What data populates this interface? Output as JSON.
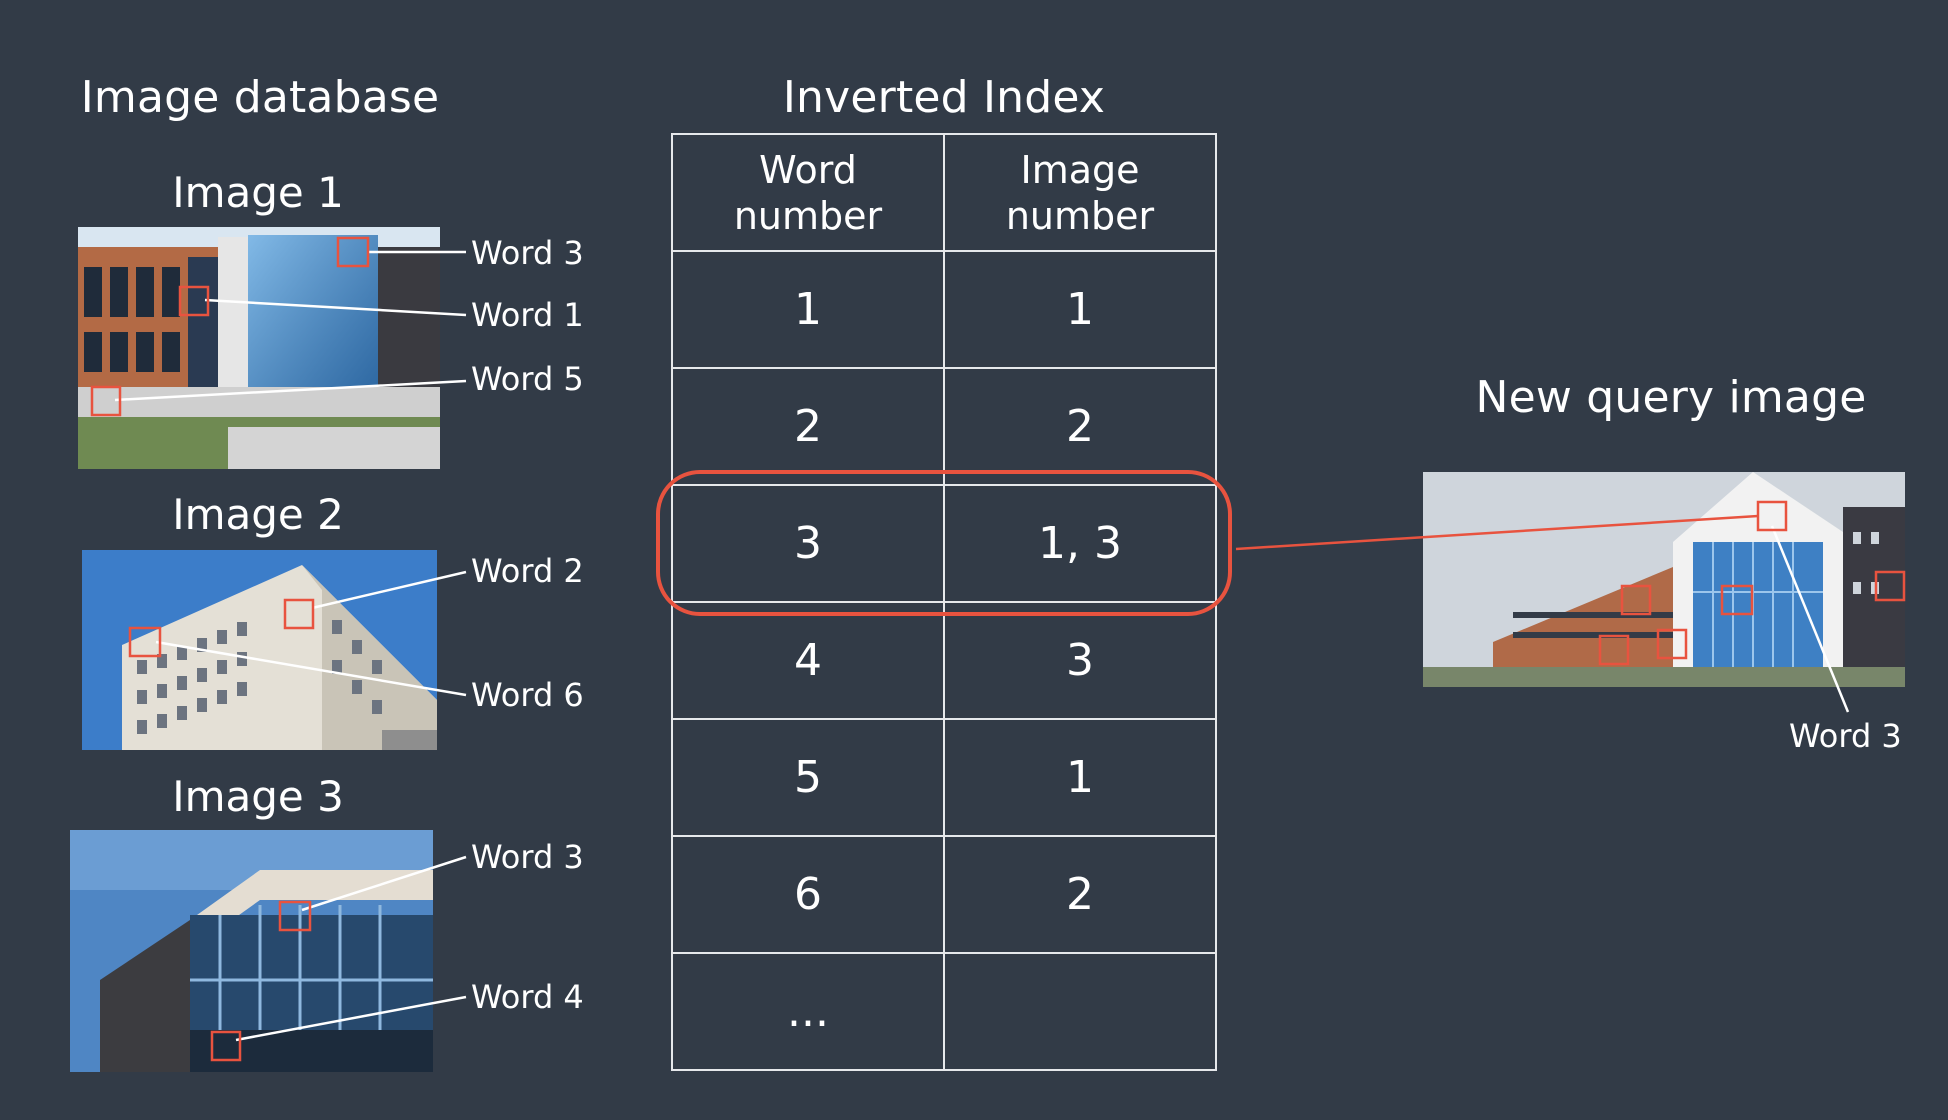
{
  "headings": {
    "database": "Image database",
    "index": "Inverted Index",
    "query": "New query image"
  },
  "images": [
    {
      "label": "Image 1",
      "words": [
        "Word 3",
        "Word 1",
        "Word 5"
      ]
    },
    {
      "label": "Image 2",
      "words": [
        "Word 2",
        "Word 6"
      ]
    },
    {
      "label": "Image 3",
      "words": [
        "Word 3",
        "Word 4"
      ]
    }
  ],
  "query_word": "Word 3",
  "table": {
    "columns": [
      "Word\nnumber",
      "Image\nnumber"
    ],
    "rows": [
      {
        "word": "1",
        "image": "1"
      },
      {
        "word": "2",
        "image": "2"
      },
      {
        "word": "3",
        "image": "1, 3"
      },
      {
        "word": "4",
        "image": "3"
      },
      {
        "word": "5",
        "image": "1"
      },
      {
        "word": "6",
        "image": "2"
      },
      {
        "word": "...",
        "image": ""
      }
    ],
    "highlighted_row": 3
  },
  "colors": {
    "background": "#323b47",
    "highlight": "#e8533f",
    "lines": "#ffffff"
  }
}
